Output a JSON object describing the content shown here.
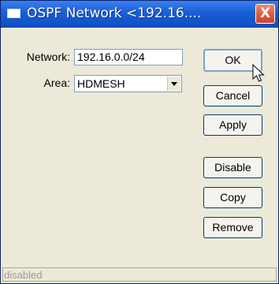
{
  "window": {
    "title": "OSPF Network <192.16....",
    "close_symbol": "X",
    "title_icon": "window-icon"
  },
  "form": {
    "network_label": "Network:",
    "network_value": "192.16.0.0/24",
    "area_label": "Area:",
    "area_value": "HDMESH"
  },
  "buttons": {
    "ok": "OK",
    "cancel": "Cancel",
    "apply": "Apply",
    "disable": "Disable",
    "copy": "Copy",
    "remove": "Remove"
  },
  "status_bar": {
    "text": "disabled"
  },
  "colors": {
    "titlebar": "#1a5fd6",
    "close": "#d65a3d",
    "dialog_background": "#ece9d8",
    "status_text": "#9a9a9a"
  }
}
